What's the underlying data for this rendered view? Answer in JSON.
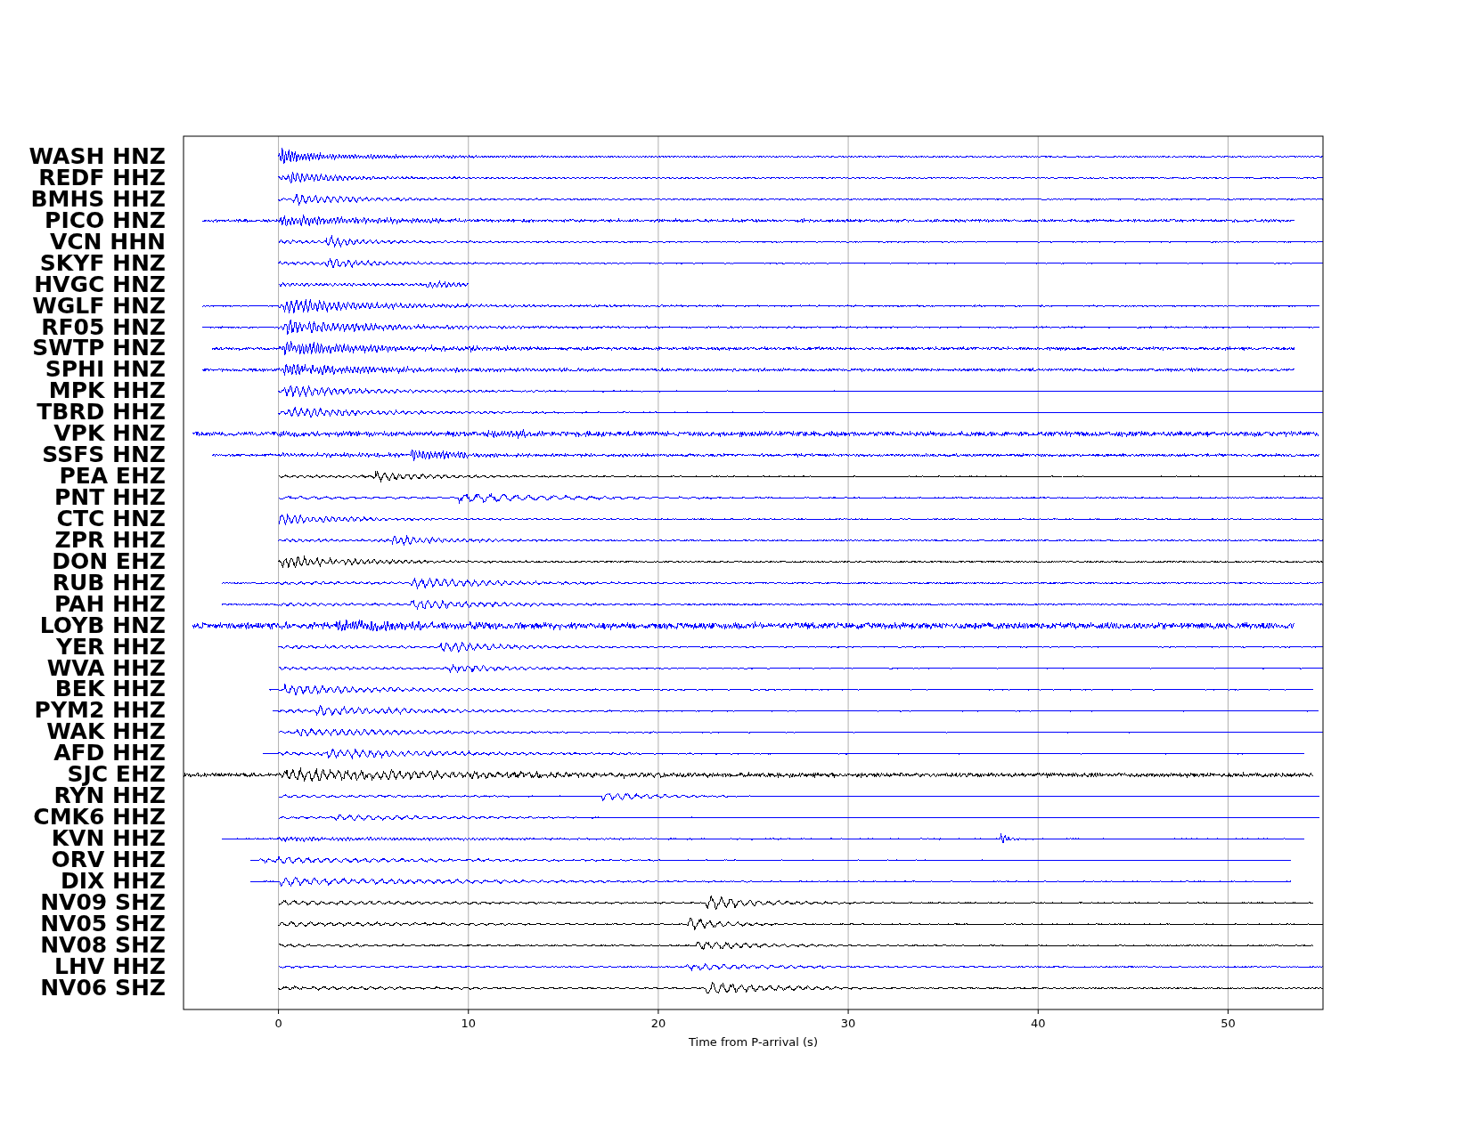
{
  "traces": [
    {
      "label": "WASH HNZ",
      "color": "#0000ff"
    },
    {
      "label": "REDF HHZ",
      "color": "#0000ff"
    },
    {
      "label": "BMHS HHZ",
      "color": "#0000ff"
    },
    {
      "label": "PICO HNZ",
      "color": "#0000ff"
    },
    {
      "label": "VCN HHN",
      "color": "#0000ff"
    },
    {
      "label": "SKYF HNZ",
      "color": "#0000ff"
    },
    {
      "label": "HVGC HNZ",
      "color": "#0000ff"
    },
    {
      "label": "WGLF HNZ",
      "color": "#0000ff"
    },
    {
      "label": "RF05 HNZ",
      "color": "#0000ff"
    },
    {
      "label": "SWTP HNZ",
      "color": "#0000ff"
    },
    {
      "label": "SPHI HNZ",
      "color": "#0000ff"
    },
    {
      "label": "MPK HHZ",
      "color": "#0000ff"
    },
    {
      "label": "TBRD HHZ",
      "color": "#0000ff"
    },
    {
      "label": "VPK HNZ",
      "color": "#0000ff"
    },
    {
      "label": "SSFS HNZ",
      "color": "#0000ff"
    },
    {
      "label": "PEA EHZ",
      "color": "#000000"
    },
    {
      "label": "PNT HHZ",
      "color": "#0000ff"
    },
    {
      "label": "CTC HNZ",
      "color": "#0000ff"
    },
    {
      "label": "ZPR HHZ",
      "color": "#0000ff"
    },
    {
      "label": "DON EHZ",
      "color": "#000000"
    },
    {
      "label": "RUB HHZ",
      "color": "#0000ff"
    },
    {
      "label": "PAH HHZ",
      "color": "#0000ff"
    },
    {
      "label": "LOYB HNZ",
      "color": "#0000ff"
    },
    {
      "label": "YER HHZ",
      "color": "#0000ff"
    },
    {
      "label": "WVA HHZ",
      "color": "#0000ff"
    },
    {
      "label": "BEK HHZ",
      "color": "#0000ff"
    },
    {
      "label": "PYM2 HHZ",
      "color": "#0000ff"
    },
    {
      "label": "WAK HHZ",
      "color": "#0000ff"
    },
    {
      "label": "AFD HHZ",
      "color": "#0000ff"
    },
    {
      "label": "SJC EHZ",
      "color": "#000000"
    },
    {
      "label": "RYN HHZ",
      "color": "#0000ff"
    },
    {
      "label": "CMK6 HHZ",
      "color": "#0000ff"
    },
    {
      "label": "KVN HHZ",
      "color": "#0000ff"
    },
    {
      "label": "ORV HHZ",
      "color": "#0000ff"
    },
    {
      "label": "DIX HHZ",
      "color": "#0000ff"
    },
    {
      "label": "NV09 SHZ",
      "color": "#000000"
    },
    {
      "label": "NV05 SHZ",
      "color": "#000000"
    },
    {
      "label": "NV08 SHZ",
      "color": "#000000"
    },
    {
      "label": "LHV HHZ",
      "color": "#0000ff"
    },
    {
      "label": "NV06 SHZ",
      "color": "#000000"
    }
  ],
  "xaxis": {
    "label": "Time from P-arrival (s)",
    "ticks": [
      "0",
      "10",
      "20",
      "30",
      "40",
      "50"
    ]
  }
}
